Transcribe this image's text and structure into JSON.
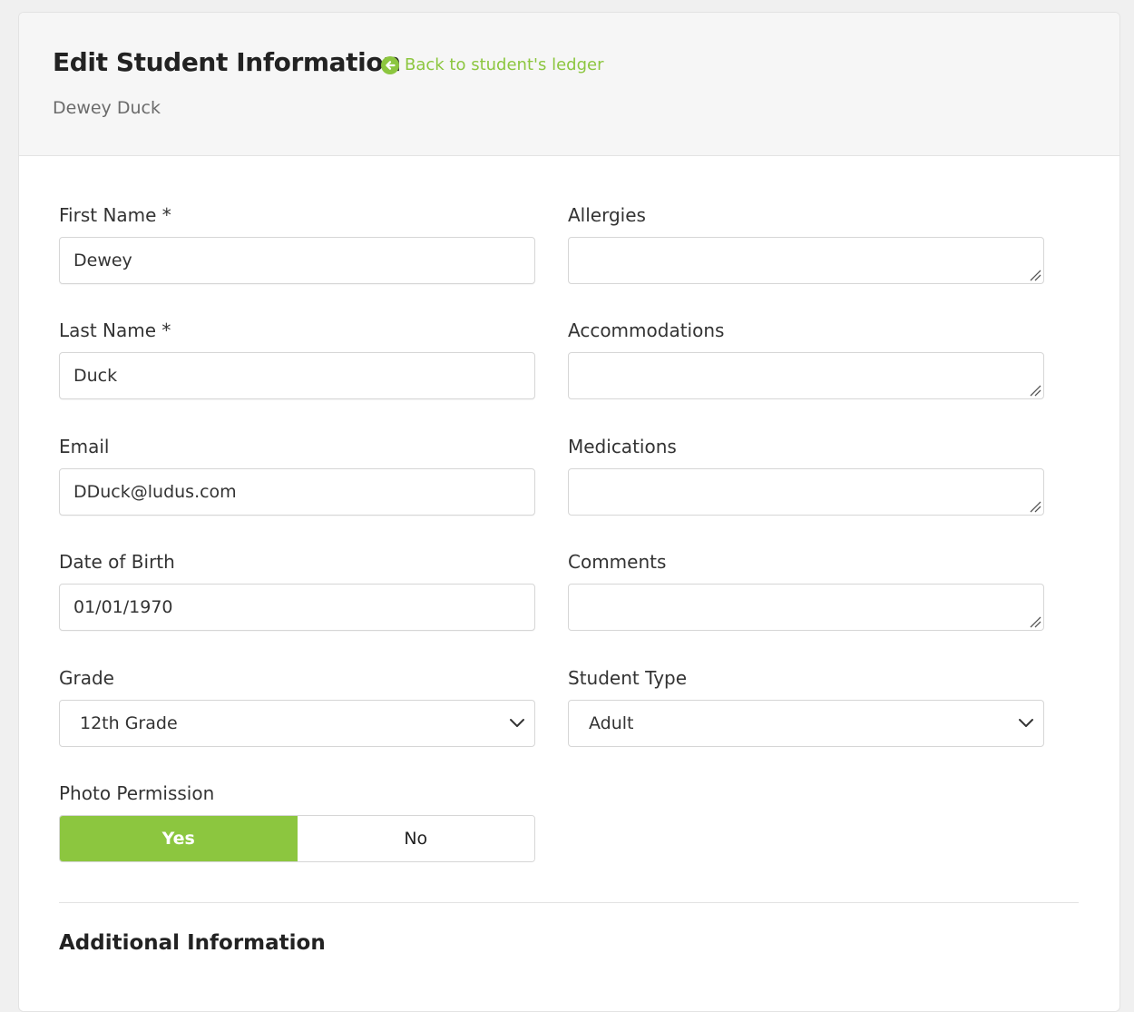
{
  "header": {
    "title": "Edit Student Information",
    "back_link": "Back to student's ledger",
    "subtitle": "Dewey Duck"
  },
  "form": {
    "first_name": {
      "label": "First Name *",
      "value": "Dewey"
    },
    "last_name": {
      "label": "Last Name *",
      "value": "Duck"
    },
    "email": {
      "label": "Email",
      "value": "DDuck@ludus.com"
    },
    "dob": {
      "label": "Date of Birth",
      "value": "01/01/1970"
    },
    "grade": {
      "label": "Grade",
      "value": "12th Grade"
    },
    "allergies": {
      "label": "Allergies",
      "value": ""
    },
    "accommodations": {
      "label": "Accommodations",
      "value": ""
    },
    "medications": {
      "label": "Medications",
      "value": ""
    },
    "comments": {
      "label": "Comments",
      "value": ""
    },
    "student_type": {
      "label": "Student Type",
      "value": "Adult"
    },
    "photo_permission": {
      "label": "Photo Permission",
      "yes": "Yes",
      "no": "No",
      "selected": "Yes"
    }
  },
  "additional": {
    "title": "Additional Information"
  },
  "icons": {
    "back": "arrow-left-circle-icon",
    "select": "chevron-down-icon",
    "resize": "resize-grip-icon"
  },
  "colors": {
    "accent": "#8cc63f"
  }
}
